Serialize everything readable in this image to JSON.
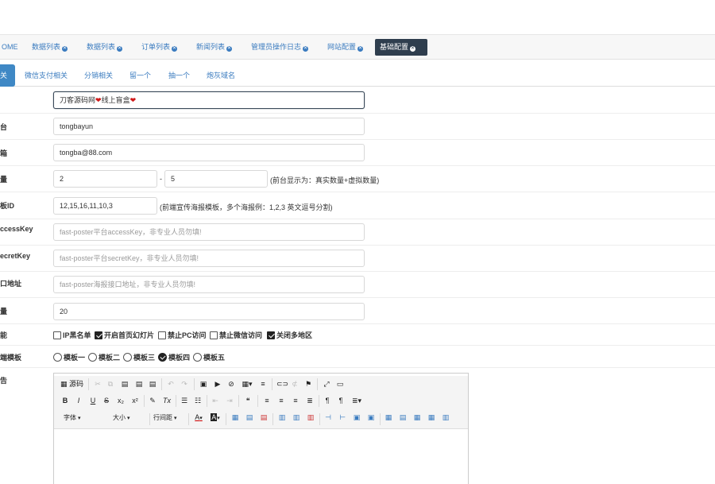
{
  "tabs": [
    {
      "label": "OME",
      "close": false
    },
    {
      "label": "数据列表",
      "close": true
    },
    {
      "label": "数据列表",
      "close": true
    },
    {
      "label": "订单列表",
      "close": true
    },
    {
      "label": "新闻列表",
      "close": true
    },
    {
      "label": "管理员操作日志",
      "close": true
    },
    {
      "label": "网站配置",
      "close": true
    },
    {
      "label": "基础配置",
      "close": true,
      "active": true
    }
  ],
  "subtabs": [
    "关",
    "微信支付相关",
    "分销相关",
    "留一个",
    "抽一个",
    "炮灰域名"
  ],
  "form": {
    "site_name": {
      "label": "",
      "value": "刀客源码网",
      "value_mid": "线上盲盒"
    },
    "platform": {
      "label": "台",
      "value": "tongbayun"
    },
    "email": {
      "label": "箱",
      "value": "tongba@88.com"
    },
    "count": {
      "label": "量",
      "min": "2",
      "sep": "-",
      "max": "5",
      "note": "(前台显示为：真实数量+虚拟数量)"
    },
    "poster_id": {
      "label": "板ID",
      "value": "12,15,16,11,10,3",
      "note": "(前端宣传海报模板，多个海报例：1,2,3 英文逗号分割)"
    },
    "access_key": {
      "label": "ccessKey",
      "placeholder": "fast-poster平台accessKey，非专业人员勿填!"
    },
    "secret_key": {
      "label": "ecretKey",
      "placeholder": "fast-poster平台secretKey，非专业人员勿填!"
    },
    "api_url": {
      "label": "口地址",
      "placeholder": "fast-poster海报接口地址，非专业人员勿填!"
    },
    "number": {
      "label": "量",
      "value": "20"
    },
    "features": {
      "label": "能",
      "options": [
        {
          "label": "IP黑名单",
          "checked": false
        },
        {
          "label": "开启首页幻灯片",
          "checked": true
        },
        {
          "label": "禁止PC访问",
          "checked": false
        },
        {
          "label": "禁止微信访问",
          "checked": false
        },
        {
          "label": "关闭多地区",
          "checked": true
        }
      ]
    },
    "template": {
      "label": "端模板",
      "options": [
        {
          "label": "模板一",
          "selected": false
        },
        {
          "label": "模板二",
          "selected": false
        },
        {
          "label": "模板三",
          "selected": false
        },
        {
          "label": "模板四",
          "selected": true
        },
        {
          "label": "模板五",
          "selected": false
        }
      ]
    },
    "notice": {
      "label": "告"
    }
  },
  "editor": {
    "source_label": "源码",
    "font_label": "字体",
    "size_label": "大小",
    "lineheight_label": "行间距",
    "bold": "B",
    "italic": "I",
    "underline": "U",
    "strike": "S",
    "sub": "x₂",
    "sup": "x²",
    "clear": "Tx",
    "ltr": "¶",
    "rtl": "¶",
    "font_color": "A",
    "bg_color": "A"
  },
  "colors": {
    "active_tab_bg": "#2f3e4e",
    "link": "#3a7bbf",
    "subtab_active": "#3f88c5"
  }
}
